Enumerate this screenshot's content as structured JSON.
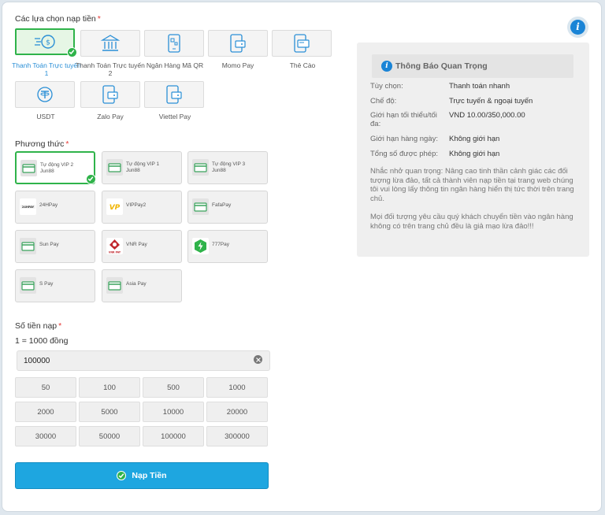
{
  "options_section": {
    "title": "Các lựa chọn nạp tiền",
    "required_mark": "*"
  },
  "options": [
    {
      "label": "Thanh Toán Trực tuyến 1",
      "icon": "fast-coin-icon",
      "selected": true
    },
    {
      "label": "Thanh Toán Trực tuyến 2",
      "icon": "bank-icon",
      "selected": false
    },
    {
      "label": "Ngân Hàng Mã QR",
      "icon": "qr-phone-icon",
      "selected": false
    },
    {
      "label": "Momo Pay",
      "icon": "phone-wallet-icon",
      "selected": false
    },
    {
      "label": "Thẻ Cào",
      "icon": "card-phone-icon",
      "selected": false
    },
    {
      "label": "USDT",
      "icon": "usdt-icon",
      "selected": false
    },
    {
      "label": "Zalo Pay",
      "icon": "phone-wallet-icon",
      "selected": false
    },
    {
      "label": "Viettel Pay",
      "icon": "phone-wallet-icon",
      "selected": false
    }
  ],
  "method_section": {
    "title": "Phương thức",
    "required_mark": "*"
  },
  "methods": [
    {
      "name": "Tự động VIP 2",
      "sub": "Jun88",
      "icon": "card-icon",
      "selected": true
    },
    {
      "name": "Tự động VIP 1",
      "sub": "Jun88",
      "icon": "card-icon",
      "selected": false
    },
    {
      "name": "Tự động VIP 3",
      "sub": "Jun88",
      "icon": "card-icon",
      "selected": false
    },
    {
      "name": "24HPay",
      "sub": "",
      "icon": "24hpay-logo-icon",
      "selected": false
    },
    {
      "name": "VIPPay2",
      "sub": "",
      "icon": "vippay-logo-icon",
      "selected": false
    },
    {
      "name": "FafaPay",
      "sub": "",
      "icon": "card-icon",
      "selected": false
    },
    {
      "name": "Sun Pay",
      "sub": "",
      "icon": "card-icon",
      "selected": false
    },
    {
      "name": "VNR Pay",
      "sub": "",
      "icon": "vnr-logo-icon",
      "selected": false
    },
    {
      "name": "777Pay",
      "sub": "",
      "icon": "777pay-logo-icon",
      "selected": false
    },
    {
      "name": "S Pay",
      "sub": "",
      "icon": "card-icon",
      "selected": false
    },
    {
      "name": "Asia Pay",
      "sub": "",
      "icon": "card-icon",
      "selected": false
    }
  ],
  "amount_section": {
    "title": "Số tiền nạp",
    "required_mark": "*",
    "rate": "1 = 1000 đồng",
    "value": "100000"
  },
  "quick_amounts": [
    "50",
    "100",
    "500",
    "1000",
    "2000",
    "5000",
    "10000",
    "20000",
    "30000",
    "50000",
    "100000",
    "300000"
  ],
  "submit": {
    "label": "Nạp Tiền"
  },
  "notice": {
    "title": "Thông Báo Quan Trọng",
    "rows": [
      {
        "key": "Tùy chọn:",
        "value": "Thanh toán nhanh"
      },
      {
        "key": "Chế độ:",
        "value": "Trực tuyến & ngoại tuyến"
      },
      {
        "key": "Giới hạn tối thiểu/tối đa:",
        "value": "VND 10.00/350,000.00"
      },
      {
        "key": "Giới hạn hàng ngày:",
        "value": "Không giới hạn"
      },
      {
        "key": "Tổng số được phép:",
        "value": "Không giới hạn"
      }
    ],
    "reminder": "Nhắc nhở quan trọng: Nâng cao tinh thần cảnh giác các đối tượng lừa đảo, tất cả thành viên nạp tiền tại trang web chúng tôi vui lòng lấy thông tin ngân hàng hiển thị tức thời trên trang chủ.",
    "warning": "Mọi đối tượng yêu cầu quý khách chuyển tiền vào ngân hàng không có trên trang chủ đều là giả mạo lừa đảo!!!"
  },
  "colors": {
    "accent": "#1ea6e0",
    "selected": "#2fb34a",
    "info": "#1a84d6"
  },
  "logo_text": {
    "h24": "24HPAY",
    "vnr": "VNR PAY",
    "vp": "VP"
  }
}
